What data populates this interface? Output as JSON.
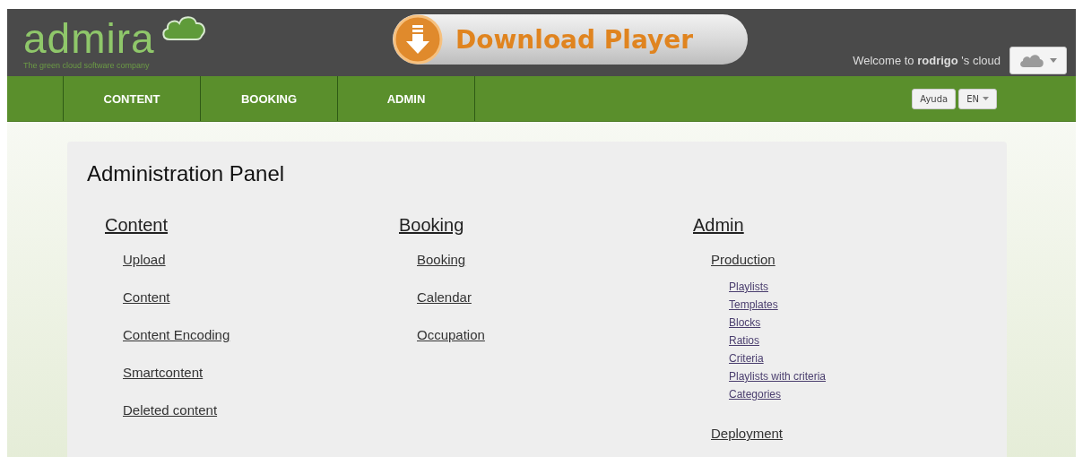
{
  "header": {
    "logo": "admira",
    "tagline": "The green cloud software company",
    "download_button": "Download Player",
    "welcome": "Welcome to **rodrigo** 's cloud"
  },
  "nav": {
    "tabs": [
      {
        "label": "CONTENT"
      },
      {
        "label": "BOOKING"
      },
      {
        "label": "ADMIN"
      }
    ],
    "help_button": "Ayuda",
    "language": "EN"
  },
  "panel": {
    "title": "Administration Panel",
    "sections": [
      {
        "title": "Content",
        "items": [
          {
            "label": "Upload"
          },
          {
            "label": "Content"
          },
          {
            "label": "Content Encoding"
          },
          {
            "label": "Smartcontent"
          },
          {
            "label": "Deleted content"
          }
        ]
      },
      {
        "title": "Booking",
        "items": [
          {
            "label": "Booking"
          },
          {
            "label": "Calendar"
          },
          {
            "label": "Occupation"
          }
        ]
      },
      {
        "title": "Admin",
        "items": [
          {
            "label": "Production",
            "children": [
              {
                "label": "Playlists"
              },
              {
                "label": "Templates"
              },
              {
                "label": "Blocks"
              },
              {
                "label": "Ratios"
              },
              {
                "label": "Criteria"
              },
              {
                "label": "Playlists with criteria"
              },
              {
                "label": "Categories"
              }
            ]
          },
          {
            "label": "Deployment"
          }
        ]
      }
    ]
  }
}
